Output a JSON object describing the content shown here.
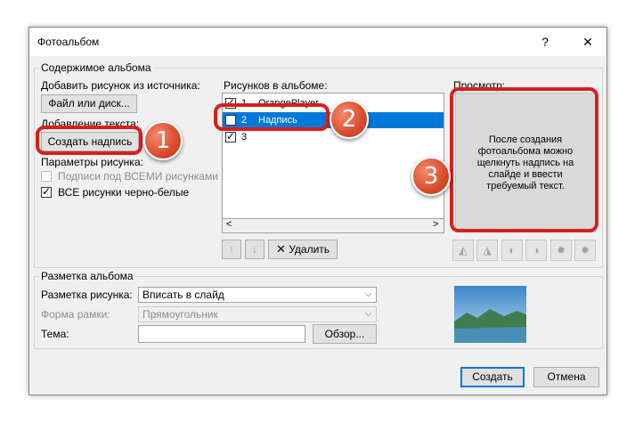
{
  "window": {
    "title": "Фотоальбом",
    "help_label": "?",
    "close_label": "✕"
  },
  "content_group": {
    "legend": "Содержимое альбома",
    "add_picture_label": "Добавить рисунок из источника:",
    "file_button": "Файл или диск...",
    "add_text_label": "Добавление текста:",
    "create_caption_button": "Создать надпись",
    "picture_options_label": "Параметры рисунка:",
    "captions_option": {
      "label": "Подписи под ВСЕМИ рисунками",
      "checked": false,
      "enabled": false
    },
    "bw_option": {
      "label": "ВСЕ рисунки черно-белые",
      "checked": true,
      "enabled": true
    },
    "pictures_label": "Рисунков в альбоме:",
    "pictures": [
      {
        "num": "1",
        "name": "OrangePlayer",
        "checked": true,
        "selected": false
      },
      {
        "num": "2",
        "name": "Надпись",
        "checked": false,
        "selected": true
      },
      {
        "num": "3",
        "name": "",
        "checked": true,
        "selected": false
      }
    ],
    "delete_button": "Удалить",
    "preview_label": "Просмотр:",
    "preview_text": "После создания фотоальбома можно щелкнуть надпись на слайде и ввести требуемый текст."
  },
  "layout_group": {
    "legend": "Разметка альбома",
    "picture_layout_label": "Разметка рисунка:",
    "picture_layout_value": "Вписать в слайд",
    "frame_shape_label": "Форма рамки:",
    "frame_shape_value": "Прямоугольник",
    "theme_label": "Тема:",
    "theme_value": "",
    "browse_button": "Обзор..."
  },
  "footer": {
    "create_button": "Создать",
    "cancel_button": "Отмена"
  },
  "annotations": {
    "step1": "1",
    "step2": "2",
    "step3": "3",
    "color": "#d91e1e"
  }
}
